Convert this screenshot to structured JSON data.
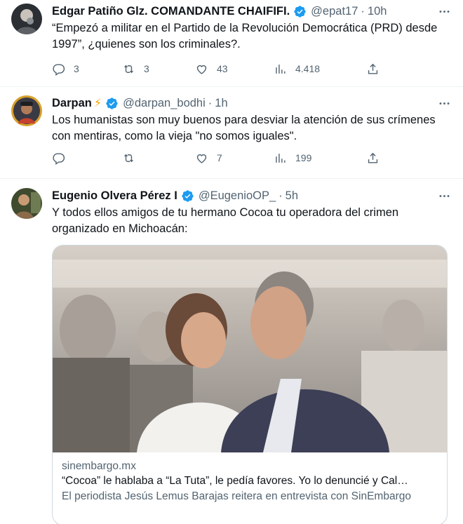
{
  "tweets": [
    {
      "name": "Edgar Patiño Glz. COMANDANTE CHAIFIFI.",
      "handle": "@epat17",
      "time": "10h",
      "text": "“Empezó a militar en el Partido de la Revolución Democrática (PRD) desde 1997”,  ¿quienes son los criminales?.",
      "replies": "3",
      "retweets": "3",
      "likes": "43",
      "views": "4.418",
      "verified": true
    },
    {
      "name": "Darpan",
      "emoji": "⚡",
      "handle": "@darpan_bodhi",
      "time": "1h",
      "text": "Los humanistas son muy buenos para desviar la atención de sus crímenes con mentiras, como la vieja \"no somos iguales\".",
      "replies": "",
      "retweets": "",
      "likes": "7",
      "views": "199",
      "verified": true
    },
    {
      "name": "Eugenio Olvera Pérez I",
      "handle": "@EugenioOP_",
      "time": "5h",
      "text": "Y todos ellos amigos de tu hermano Cocoa tu operadora del crimen organizado en Michoacán:",
      "verified": true,
      "card": {
        "domain": "sinembargo.mx",
        "title": "“Cocoa” le hablaba a “La Tuta”, le pedía favores. Yo lo denuncié y Cal…",
        "description": "El periodista Jesús Lemus Barajas reitera en entrevista con SinEmbargo"
      }
    }
  ],
  "colors": {
    "verified": "#1d9bf0",
    "muted": "#536471",
    "text": "#0f1419",
    "divider": "#eff3f4"
  },
  "icons": [
    "reply-icon",
    "retweet-icon",
    "like-icon",
    "views-icon",
    "share-icon",
    "more-icon",
    "verified-badge-icon"
  ]
}
